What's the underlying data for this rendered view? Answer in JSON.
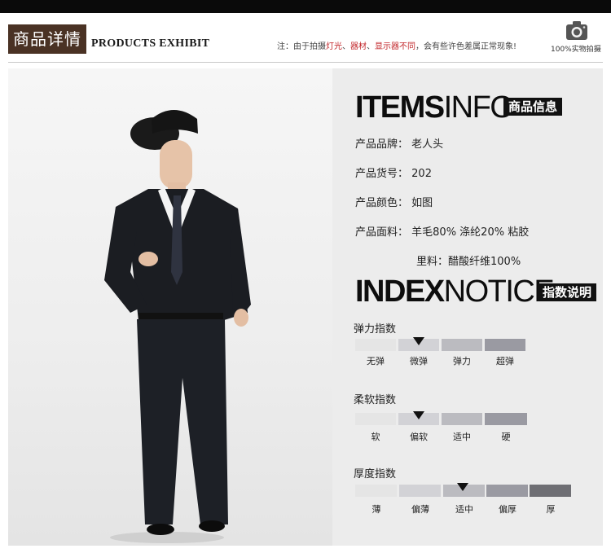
{
  "header": {
    "badge": "商品详情",
    "subtitle": "PRODUCTS EXHIBIT",
    "note_prefix": "注：由于拍摄",
    "note_lighting": "灯光",
    "note_sep1": "、",
    "note_equipment": "器材",
    "note_sep2": "、",
    "note_display": "显示器不同",
    "note_suffix": "，会有些许色差属正常现象!",
    "camera_label": "100%实物拍摄",
    "camera_icon": "camera-icon"
  },
  "items_info": {
    "title_bold": "ITEMS",
    "title_thin": "INFO",
    "tag": "商品信息",
    "rows": [
      {
        "label": "产品品牌：",
        "value": "老人头"
      },
      {
        "label": "产品货号：",
        "value": "202"
      },
      {
        "label": "产品颜色：",
        "value": "如图"
      },
      {
        "label": "产品面料：",
        "value": "羊毛80% 涤纶20% 粘胶"
      }
    ],
    "lining_label": "里料：",
    "lining_value": "醋酸纤维100%"
  },
  "index_notice": {
    "title_bold": "INDEX",
    "title_thin": "NOTICE",
    "tag": "指数说明",
    "scales": [
      {
        "title": "弹力指数",
        "labels": [
          "无弹",
          "微弹",
          "弹力",
          "超弹"
        ],
        "selected": 1
      },
      {
        "title": "柔软指数",
        "labels": [
          "软",
          "偏软",
          "适中",
          "硬"
        ],
        "selected": 1
      },
      {
        "title": "厚度指数",
        "labels": [
          "薄",
          "偏薄",
          "适中",
          "偏厚",
          "厚"
        ],
        "selected": 2
      }
    ]
  },
  "colors": {
    "badge_bg": "#4a3224",
    "note_red": "#c2262a",
    "tag_bg": "#111111",
    "panel_bg": "#ececec",
    "segment_shades": [
      "#e5e5e5",
      "#d2d2d6",
      "#bbbbc0",
      "#9a9aa2",
      "#6f6f74"
    ]
  }
}
